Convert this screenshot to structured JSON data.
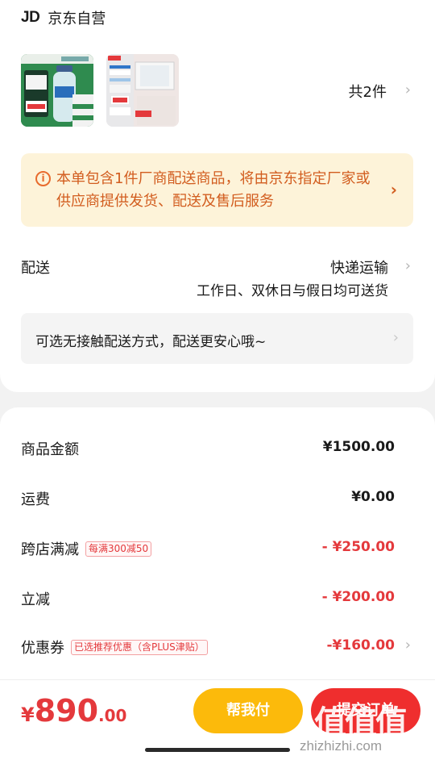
{
  "shop": {
    "logo": "JD",
    "name": "京东自营"
  },
  "products": {
    "images": [
      "product-water-bottle-icon",
      "product-cabinet-mirror-icon"
    ],
    "count_label": "共2件"
  },
  "notice": {
    "icon": "info-icon",
    "text": "本单包含1件厂商配送商品，将由京东指定厂家或供应商提供发货、配送及售后服务",
    "color": "#d25d1f"
  },
  "shipping": {
    "label": "配送",
    "method": "快递运输",
    "note": "工作日、双休日与假日均可送货",
    "contactless": "可选无接触配送方式，配送更安心哦~"
  },
  "summary": {
    "rows": [
      {
        "label": "商品金额",
        "tag": "",
        "amount": "¥1500.00"
      },
      {
        "label": "运费",
        "tag": "",
        "amount": "¥0.00"
      },
      {
        "label": "跨店满减",
        "tag": "每满300减50",
        "amount": "- ¥250.00"
      },
      {
        "label": "立减",
        "tag": "",
        "amount": "- ¥200.00"
      },
      {
        "label": "优惠券",
        "tag": "已选推荐优惠（含PLUS津贴）",
        "amount": "-¥160.00"
      }
    ]
  },
  "bottom": {
    "price_currency": "¥",
    "price_int": "890",
    "price_dec": ".00",
    "help_pay_label": "帮我付",
    "submit_label": "提交订单",
    "accent_color": "#e4393c"
  },
  "watermark": {
    "glyphs": "值值值",
    "url": "zhizhizhi.com"
  }
}
